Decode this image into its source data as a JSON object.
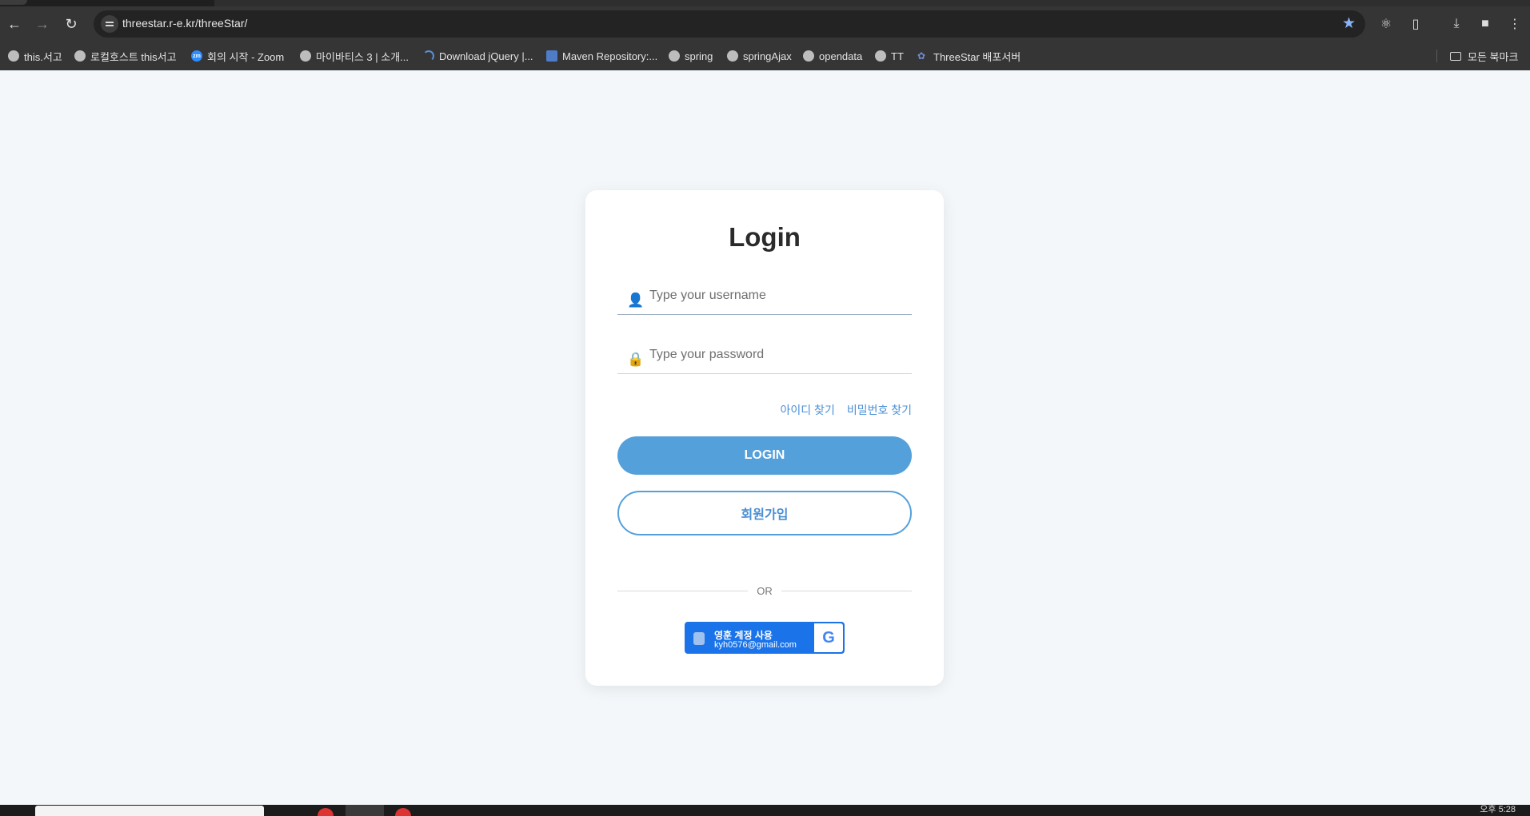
{
  "browser": {
    "url": "threestar.r-e.kr/threeStar/",
    "bookmarks": [
      {
        "label": "this.서고",
        "icon": "globe-icon"
      },
      {
        "label": "로컬호스트 this서고",
        "icon": "globe-icon"
      },
      {
        "label": "회의 시작 - Zoom",
        "icon": "zoom-icon"
      },
      {
        "label": "마이바티스 3 | 소개...",
        "icon": "globe-icon"
      },
      {
        "label": "Download jQuery |...",
        "icon": "jquery-icon"
      },
      {
        "label": "Maven Repository:...",
        "icon": "maven-icon"
      },
      {
        "label": "spring",
        "icon": "globe-icon"
      },
      {
        "label": "springAjax",
        "icon": "globe-icon"
      },
      {
        "label": "opendata",
        "icon": "globe-icon"
      },
      {
        "label": "TT",
        "icon": "globe-icon"
      },
      {
        "label": "ThreeStar 배포서버",
        "icon": "threestar-icon"
      }
    ],
    "all_bookmarks_label": "모든 북마크"
  },
  "login": {
    "title": "Login",
    "username_placeholder": "Type your username",
    "password_placeholder": "Type your password",
    "find_id": "아이디 찾기",
    "find_password": "비밀번호 찾기",
    "login_button": "LOGIN",
    "signup_button": "회원가입",
    "divider": "OR",
    "google": {
      "name": "영훈 계정 사용",
      "email": "kyh0576@gmail.com",
      "logo": "G"
    }
  },
  "taskbar": {
    "clock": "오후 5:28"
  },
  "colors": {
    "accent": "#54a0db",
    "link": "#4a8fd4",
    "google_blue": "#1a73e8",
    "page_bg": "#f3f7fa"
  }
}
